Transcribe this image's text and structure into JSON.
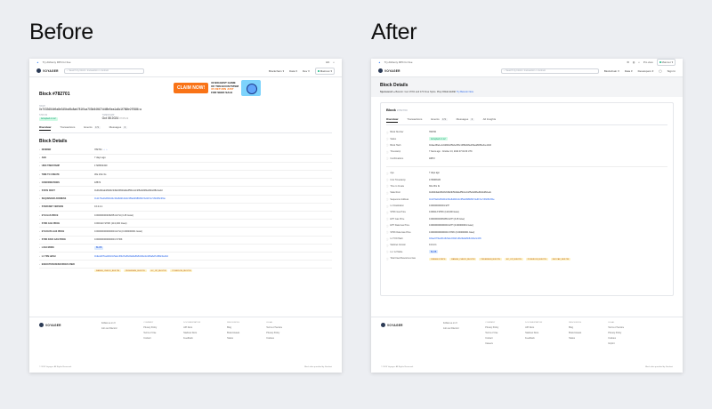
{
  "headings": {
    "before": "Before",
    "after": "After"
  },
  "before": {
    "topbar": {
      "promo": "Try Alchemy RPC for free",
      "lang": "EN"
    },
    "nav": {
      "logo": "VOYAGER",
      "search_placeholder": "Search by block / transaction / contract",
      "links": [
        "Blockchain",
        "Data",
        "Dev"
      ],
      "network": "Mainnet"
    },
    "block_title": "Block #782701",
    "ad": {
      "button": "CLAIM NOW!",
      "line1": "#2 BIGGEST GAME",
      "line2": "OF TON ECOSYSTEM",
      "line3": "X5 RETURN JUST",
      "line4": "FOR SEED SALE"
    },
    "hash_label": "HASH",
    "hash": "0x7033654b9a8e345bcf8c8ab781f0ca703b84f407d4f8e5ea1a8c1f786fe2f7686",
    "status_label": "STATUS",
    "status_value": "Accepted on L2",
    "timestamp_label": "TIMESTAMP",
    "timestamp_value": "Oct 08 2024",
    "timestamp_time": "07:05:22",
    "tabs": [
      "Overview",
      "Transactions",
      "Events",
      "Messages"
    ],
    "tab_counts": [
      "",
      "",
      "171",
      "0"
    ],
    "section_title": "Block Details",
    "details": [
      {
        "k": "Number",
        "v": "782701"
      },
      {
        "k": "Age",
        "v": "7 days ago"
      },
      {
        "k": "Unix Timestamp",
        "v": "1728363430"
      },
      {
        "k": "Time to Create",
        "v": "30s 23m 0s"
      },
      {
        "k": "Confirmations",
        "v": "18872"
      },
      {
        "k": "State Root",
        "v": "0x4b4bbab2f9d3c34924b5b3a6eff5b1c2c2f5e9d3fbe6bb2d8c1a4d"
      },
      {
        "k": "Sequencer Address",
        "v": "0x1176a1bd84444c30e8d2b1bdc3f5a0d98bf9b7de9b7e7c6b0f6c3f4e",
        "link": true
      },
      {
        "k": "Starknet Version",
        "v": "0.13.2.1"
      },
      {
        "k": "ETH Gas Price",
        "v": "0.000000003452651 ETH (3.45 Gwei)"
      },
      {
        "k": "STRK Gas Price",
        "v": "0.000113 STRK (113,000 Gwei)"
      },
      {
        "k": "ETH Data Gas Price",
        "v": "0.000000000000001 ETH (0.000000001 Gwei)"
      },
      {
        "k": "STRK Data Gas Price",
        "v": "0.000000000000001 STRK"
      },
      {
        "k": "L1DA Mode",
        "v": "BLOB"
      },
      {
        "k": "L1 TXN Hash",
        "v": "0x9e22f7ba43b16c5a1c6f4d7e8b29a6a5b8d1f2e3c4b5a6d7e8f9c0a1b2",
        "link": true
      },
      {
        "k": "Execution Resources Used",
        "v": ""
      }
    ],
    "resource_tags": [
      "RANGE_CHECK_BUILTIN",
      "PEDERSEN_BUILTIN",
      "EC_OP_BUILTIN",
      "POSEIDON_BUILTIN"
    ],
    "footer": {
      "social": [
        "Follow us on X",
        "Join our Discord"
      ],
      "cols": [
        {
          "h": "Company",
          "items": [
            "Privacy Policy",
            "Terms of Use",
            "Contact"
          ]
        },
        {
          "h": "Documentation",
          "items": [
            "API Docs",
            "Starknet Docs",
            "Feedback"
          ]
        },
        {
          "h": "Resources",
          "items": [
            "Blog",
            "Brand Assets",
            "Status"
          ]
        },
        {
          "h": "Legal",
          "items": [
            "Terms of Service",
            "Privacy Policy",
            "Cookies"
          ]
        }
      ],
      "copyright": "© 2024 Voyager. All Rights Reserved.",
      "powered": "Block data provided by Starknet"
    }
  },
  "after": {
    "topbar": {
      "promo": "Try Alchemy RPC for free",
      "pro": "Pro view",
      "network": "Mainnet"
    },
    "nav": {
      "logo": "VOYAGER",
      "search_placeholder": "Search by block / transaction / contract",
      "links": [
        "Blockchain",
        "Data",
        "Developers"
      ],
      "signin": "Sign In"
    },
    "page_title": "Block Details",
    "sponsor_prefix": "Sponsored:",
    "sponsor_text": "Betcoin: Get 170% and 170 Free Spins. Play FREE HERE!",
    "sponsor_link": "Try Betcoin Now",
    "card_title": "Block",
    "card_number": "#782700",
    "tabs": [
      "Overview",
      "Transactions",
      "Events",
      "Messages",
      "All Insights"
    ],
    "tab_counts": [
      "",
      "",
      "171",
      "0",
      ""
    ],
    "details_a": [
      {
        "k": "Block Number",
        "v": "782700"
      },
      {
        "k": "Status",
        "v": "Accepted on L2"
      },
      {
        "k": "Block Hash",
        "v": "0x4ae4f0e1e1d12fd0cd5bde45bc10f8dd18ed39ea8b0f6e3ce1fcd0"
      },
      {
        "k": "Timestamp",
        "v": "7 hours ago · October 13, 2024 07:04:30 UTC"
      },
      {
        "k": "Confirmations",
        "v": "18872"
      }
    ],
    "details_b": [
      {
        "k": "Age",
        "v": "7 days ago"
      },
      {
        "k": "Unix Timestamp",
        "v": "1728363430"
      },
      {
        "k": "Time to Create",
        "v": "30s 23m 0s"
      },
      {
        "k": "State Root",
        "v": "0x4b4bbab2f9d3c34924b5b3a6eff5b1c2c2f5e9d3fbe6bb2d8c1a4d"
      },
      {
        "k": "Sequencer Address",
        "v": "0x1176a1bd84444c30e8d2b1bdc3f5a0d98bf9b7de9b7e7c6b0f6c3f4e",
        "link": true
      },
      {
        "k": "L1 Finalization",
        "v": "0.000000000001 ETH"
      },
      {
        "k": "STRK Gas Price",
        "v": "0.000113 STRK (113,000 Gwei)"
      },
      {
        "k": "ETH Gas Price",
        "v": "0.000000003452651 ETH (3.45 Gwei)"
      },
      {
        "k": "ETH Data Gas Price",
        "v": "0.000000000000001 ETH (0.000000001 Gwei)"
      },
      {
        "k": "STRK Data Gas Price",
        "v": "0.000000000000001 STRK (0.000000001 Gwei)"
      },
      {
        "k": "L1 TXN Hash",
        "v": "0x9e22f7ba43b16c5a1c6f4d7e8b29a6a5b8d1f2e3c4b5",
        "link": true
      },
      {
        "k": "Starknet Version",
        "v": "0.13.2.1"
      },
      {
        "k": "L1 / L2 Mode",
        "v": "BLOB"
      },
      {
        "k": "Total Used Resources Gas",
        "v": ""
      }
    ],
    "resource_tags": [
      "1388066 STEPS",
      "RANGE_CHECK_BUILTIN",
      "PEDERSEN_BUILTIN",
      "EC_OP_BUILTIN",
      "POSEIDON_BUILTIN",
      "KECCAK_BUILTIN"
    ],
    "footer": {
      "social": [
        "Follow us on X",
        "Join our Discord"
      ],
      "cols": [
        {
          "h": "Company",
          "items": [
            "Privacy Policy",
            "Terms of Use",
            "Contact",
            "Careers"
          ]
        },
        {
          "h": "Documentation",
          "items": [
            "API Docs",
            "Starknet Docs",
            "Feedback"
          ]
        },
        {
          "h": "Resources",
          "items": [
            "Blog",
            "Brand Assets",
            "Status"
          ]
        },
        {
          "h": "Legal",
          "items": [
            "Terms of Service",
            "Privacy Policy",
            "Cookies",
            "Imprint"
          ]
        }
      ],
      "copyright": "© 2024 Voyager. All Rights Reserved.",
      "powered": "Block data provided by Starknet"
    }
  }
}
